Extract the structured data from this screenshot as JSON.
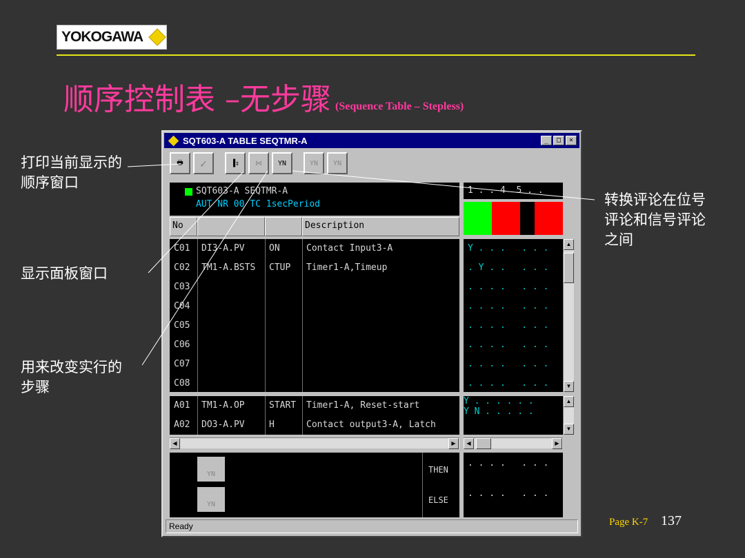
{
  "logo": {
    "text": "YOKOGAWA"
  },
  "slide": {
    "title_cn": "顺序控制表 –无步骤",
    "title_en": "(Sequence Table – Stepless)"
  },
  "callouts": {
    "print": [
      "打印当前显示的",
      "顺序窗口"
    ],
    "faceplate": [
      "显示面板窗口"
    ],
    "step": [
      "用来改变实行的",
      "步骤"
    ],
    "toggle_comment": [
      "转换评论在位号",
      "评论和信号评论",
      "之间"
    ]
  },
  "footer": {
    "page_label": "Page K-7",
    "page_number": "137"
  },
  "window": {
    "title": "SQT603-A TABLE SEQTMR-A",
    "controls": [
      "_",
      "□",
      "×"
    ],
    "status": "Ready",
    "header_line1": "SQT603-A SEQTMR-A",
    "header_line2": "AUT  NR   00    TC 1secPeriod",
    "step_ruler": "1 . . 4  5 . .",
    "toolbar": [
      {
        "name": "print",
        "label": "🖶"
      },
      {
        "name": "check",
        "label": "✓"
      },
      {
        "name": "faceplate",
        "label": "▐⇕"
      },
      {
        "name": "step",
        "label": "⋈"
      },
      {
        "name": "toggle-comment",
        "label": "YN"
      },
      {
        "name": "prev",
        "label": "YN"
      },
      {
        "name": "next",
        "label": "YN"
      }
    ],
    "columns": {
      "no": "No",
      "description": "Description"
    },
    "condition_rows": [
      {
        "no": "C01",
        "tag": "DI3-A.PV",
        "data": "ON",
        "desc": "Contact Input3-A",
        "pattern": "Y . . .   . . ."
      },
      {
        "no": "C02",
        "tag": "TM1-A.BSTS",
        "data": "CTUP",
        "desc": "Timer1-A,Timeup",
        "pattern": ". Y . .   . . ."
      },
      {
        "no": "C03",
        "tag": "",
        "data": "",
        "desc": "",
        "pattern": ". . . .   . . ."
      },
      {
        "no": "C04",
        "tag": "",
        "data": "",
        "desc": "",
        "pattern": ". . . .   . . ."
      },
      {
        "no": "C05",
        "tag": "",
        "data": "",
        "desc": "",
        "pattern": ". . . .   . . ."
      },
      {
        "no": "C06",
        "tag": "",
        "data": "",
        "desc": "",
        "pattern": ". . . .   . . ."
      },
      {
        "no": "C07",
        "tag": "",
        "data": "",
        "desc": "",
        "pattern": ". . . .   . . ."
      },
      {
        "no": "C08",
        "tag": "",
        "data": "",
        "desc": "",
        "pattern": ". . . .   . . ."
      }
    ],
    "action_rows": [
      {
        "no": "A01",
        "tag": "TM1-A.OP",
        "data": "START",
        "desc": "Timer1-A, Reset-start",
        "pattern": "Y . . .   . . ."
      },
      {
        "no": "A02",
        "tag": "DO3-A.PV",
        "data": "H",
        "desc": "Contact output3-A, Latch",
        "pattern": "Y N . .   . . ."
      }
    ],
    "then_label": "THEN",
    "else_label": "ELSE",
    "then_pattern": ". . . .   . . .",
    "else_pattern": ". . . .   . . .",
    "nav_label": "YN",
    "rule_colors": [
      "#00ff00",
      "#00ff00",
      "#ff0000",
      "#ff0000",
      "#000000",
      "#ff0000",
      "#ff0000"
    ]
  }
}
